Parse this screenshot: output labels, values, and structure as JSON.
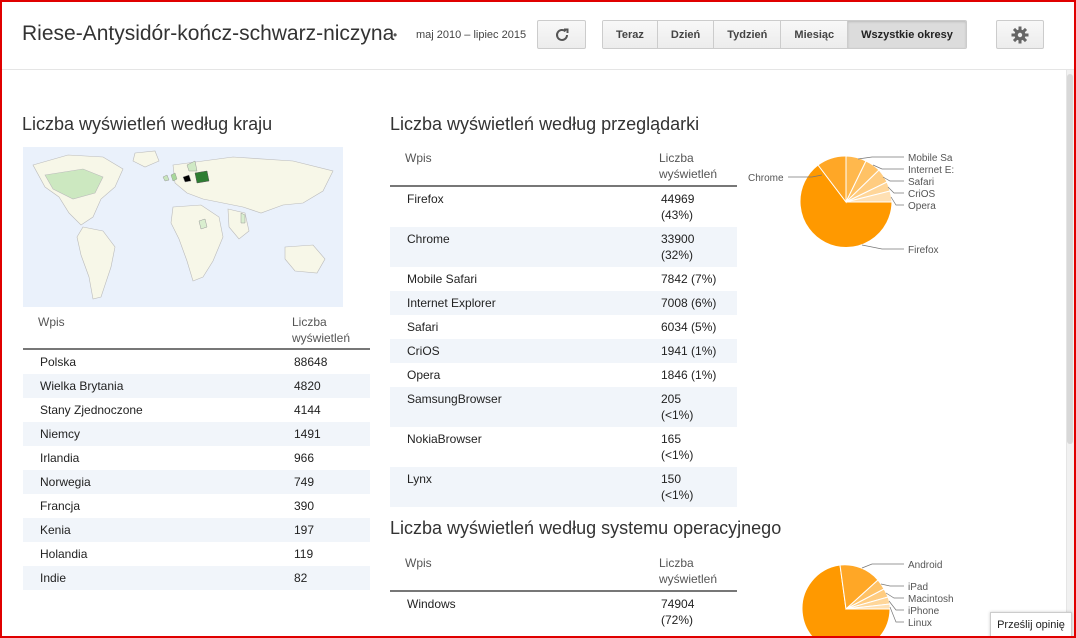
{
  "header": {
    "blog_title": "Riese-Antysidór-kończ-schwarz-niczyna",
    "separator": "•",
    "date_range": "maj 2010 – lipiec 2015",
    "periods": [
      "Teraz",
      "Dzień",
      "Tydzień",
      "Miesiąc",
      "Wszystkie okresy"
    ],
    "active_period": "Wszystkie okresy"
  },
  "country_section": {
    "title": "Liczba wyświetleń według kraju",
    "col_entry": "Wpis",
    "col_views_1": "Liczba",
    "col_views_2": "wyświetleń",
    "rows": [
      {
        "name": "Polska",
        "views": "88648"
      },
      {
        "name": "Wielka Brytania",
        "views": "4820"
      },
      {
        "name": "Stany Zjednoczone",
        "views": "4144"
      },
      {
        "name": "Niemcy",
        "views": "1491"
      },
      {
        "name": "Irlandia",
        "views": "966"
      },
      {
        "name": "Norwegia",
        "views": "749"
      },
      {
        "name": "Francja",
        "views": "390"
      },
      {
        "name": "Kenia",
        "views": "197"
      },
      {
        "name": "Holandia",
        "views": "119"
      },
      {
        "name": "Indie",
        "views": "82"
      }
    ]
  },
  "browser_section": {
    "title": "Liczba wyświetleń według przeglądarki",
    "col_entry": "Wpis",
    "col_views_1": "Liczba",
    "col_views_2": "wyświetleń",
    "rows": [
      {
        "name": "Firefox",
        "v1": "44969",
        "v2": "(43%)"
      },
      {
        "name": "Chrome",
        "v1": "33900",
        "v2": "(32%)"
      },
      {
        "name": "Mobile Safari",
        "v1": "7842 (7%)",
        "v2": ""
      },
      {
        "name": "Internet Explorer",
        "v1": "7008 (6%)",
        "v2": ""
      },
      {
        "name": "Safari",
        "v1": "6034 (5%)",
        "v2": ""
      },
      {
        "name": "CriOS",
        "v1": "1941 (1%)",
        "v2": ""
      },
      {
        "name": "Opera",
        "v1": "1846 (1%)",
        "v2": ""
      },
      {
        "name": "SamsungBrowser",
        "v1": "205",
        "v2": "(<1%)"
      },
      {
        "name": "NokiaBrowser",
        "v1": "165",
        "v2": "(<1%)"
      },
      {
        "name": "Lynx",
        "v1": "150",
        "v2": "(<1%)"
      }
    ],
    "pie_labels": [
      "Chrome",
      "Mobile Sa",
      "Internet E:",
      "Safari",
      "CriOS",
      "Opera",
      "Firefox"
    ]
  },
  "os_section": {
    "title": "Liczba wyświetleń według systemu operacyjnego",
    "col_entry": "Wpis",
    "col_views_1": "Liczba",
    "col_views_2": "wyświetleń",
    "rows": [
      {
        "name": "Windows",
        "v1": "74904",
        "v2": "(72%)"
      }
    ],
    "pie_labels": [
      "Android",
      "iPad",
      "Macintosh",
      "iPhone",
      "Linux"
    ]
  },
  "feedback_label": "Prześlij opinię",
  "colors": {
    "pie_main": "#ff9900",
    "pie_light": "#ffc266",
    "map_highlight": "#2e7d32"
  }
}
